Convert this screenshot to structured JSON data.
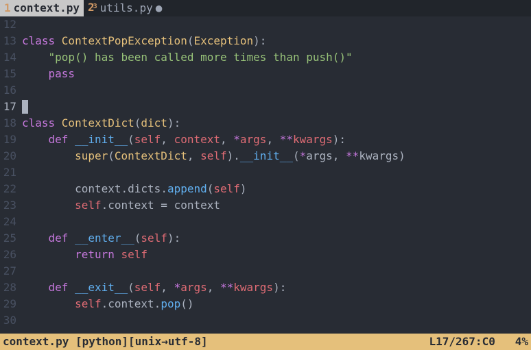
{
  "tabs": [
    {
      "index": "1",
      "sup": "",
      "name": "context.py",
      "active": true,
      "modified": false
    },
    {
      "index": "2",
      "sup": "3",
      "name": "utils.py",
      "active": false,
      "modified": true
    }
  ],
  "status": {
    "filename": "context.py",
    "filetype": "[python]",
    "encoding": "[unix→utf-8]",
    "position": "L17/267:C0",
    "percent": "4%"
  },
  "code": {
    "first_line_number": 12,
    "current_line": 17,
    "lines": [
      {
        "n": 12,
        "tokens": []
      },
      {
        "n": 13,
        "tokens": [
          {
            "t": "class ",
            "c": "kw"
          },
          {
            "t": "ContextPopException",
            "c": "cls"
          },
          {
            "t": "(",
            "c": "pun"
          },
          {
            "t": "Exception",
            "c": "bi"
          },
          {
            "t": "):",
            "c": "pun"
          }
        ]
      },
      {
        "n": 14,
        "tokens": [
          {
            "t": "    ",
            "c": "op"
          },
          {
            "t": "\"pop() has been called more times than push()\"",
            "c": "str"
          }
        ]
      },
      {
        "n": 15,
        "tokens": [
          {
            "t": "    ",
            "c": "op"
          },
          {
            "t": "pass",
            "c": "kw"
          }
        ]
      },
      {
        "n": 16,
        "tokens": []
      },
      {
        "n": 17,
        "tokens": [
          {
            "t": "CURSOR",
            "c": "cursor"
          }
        ]
      },
      {
        "n": 18,
        "tokens": [
          {
            "t": "class ",
            "c": "kw"
          },
          {
            "t": "ContextDict",
            "c": "cls"
          },
          {
            "t": "(",
            "c": "pun"
          },
          {
            "t": "dict",
            "c": "bi"
          },
          {
            "t": "):",
            "c": "pun"
          }
        ]
      },
      {
        "n": 19,
        "tokens": [
          {
            "t": "    ",
            "c": "op"
          },
          {
            "t": "def ",
            "c": "kw"
          },
          {
            "t": "__init__",
            "c": "fn"
          },
          {
            "t": "(",
            "c": "pun"
          },
          {
            "t": "self",
            "c": "slf"
          },
          {
            "t": ", ",
            "c": "pun"
          },
          {
            "t": "context",
            "c": "prm"
          },
          {
            "t": ", ",
            "c": "pun"
          },
          {
            "t": "*",
            "c": "star"
          },
          {
            "t": "args",
            "c": "prm"
          },
          {
            "t": ", ",
            "c": "pun"
          },
          {
            "t": "**",
            "c": "star"
          },
          {
            "t": "kwargs",
            "c": "prm"
          },
          {
            "t": "):",
            "c": "pun"
          }
        ]
      },
      {
        "n": 20,
        "tokens": [
          {
            "t": "        ",
            "c": "op"
          },
          {
            "t": "super",
            "c": "bi"
          },
          {
            "t": "(",
            "c": "pun"
          },
          {
            "t": "ContextDict",
            "c": "cls"
          },
          {
            "t": ", ",
            "c": "pun"
          },
          {
            "t": "self",
            "c": "slf"
          },
          {
            "t": ").",
            "c": "pun"
          },
          {
            "t": "__init__",
            "c": "fn"
          },
          {
            "t": "(",
            "c": "pun"
          },
          {
            "t": "*",
            "c": "star"
          },
          {
            "t": "args",
            "c": "op"
          },
          {
            "t": ", ",
            "c": "pun"
          },
          {
            "t": "**",
            "c": "star"
          },
          {
            "t": "kwargs",
            "c": "op"
          },
          {
            "t": ")",
            "c": "pun"
          }
        ]
      },
      {
        "n": 21,
        "tokens": []
      },
      {
        "n": 22,
        "tokens": [
          {
            "t": "        ",
            "c": "op"
          },
          {
            "t": "context",
            "c": "op"
          },
          {
            "t": ".",
            "c": "dot"
          },
          {
            "t": "dicts",
            "c": "op"
          },
          {
            "t": ".",
            "c": "dot"
          },
          {
            "t": "append",
            "c": "fn"
          },
          {
            "t": "(",
            "c": "pun"
          },
          {
            "t": "self",
            "c": "slf"
          },
          {
            "t": ")",
            "c": "pun"
          }
        ]
      },
      {
        "n": 23,
        "tokens": [
          {
            "t": "        ",
            "c": "op"
          },
          {
            "t": "self",
            "c": "slf"
          },
          {
            "t": ".",
            "c": "dot"
          },
          {
            "t": "context",
            "c": "op"
          },
          {
            "t": " = ",
            "c": "op"
          },
          {
            "t": "context",
            "c": "op"
          }
        ]
      },
      {
        "n": 24,
        "tokens": []
      },
      {
        "n": 25,
        "tokens": [
          {
            "t": "    ",
            "c": "op"
          },
          {
            "t": "def ",
            "c": "kw"
          },
          {
            "t": "__enter__",
            "c": "fn"
          },
          {
            "t": "(",
            "c": "pun"
          },
          {
            "t": "self",
            "c": "slf"
          },
          {
            "t": "):",
            "c": "pun"
          }
        ]
      },
      {
        "n": 26,
        "tokens": [
          {
            "t": "        ",
            "c": "op"
          },
          {
            "t": "return ",
            "c": "kw"
          },
          {
            "t": "self",
            "c": "slf"
          }
        ]
      },
      {
        "n": 27,
        "tokens": []
      },
      {
        "n": 28,
        "tokens": [
          {
            "t": "    ",
            "c": "op"
          },
          {
            "t": "def ",
            "c": "kw"
          },
          {
            "t": "__exit__",
            "c": "fn"
          },
          {
            "t": "(",
            "c": "pun"
          },
          {
            "t": "self",
            "c": "slf"
          },
          {
            "t": ", ",
            "c": "pun"
          },
          {
            "t": "*",
            "c": "star"
          },
          {
            "t": "args",
            "c": "prm"
          },
          {
            "t": ", ",
            "c": "pun"
          },
          {
            "t": "**",
            "c": "star"
          },
          {
            "t": "kwargs",
            "c": "prm"
          },
          {
            "t": "):",
            "c": "pun"
          }
        ]
      },
      {
        "n": 29,
        "tokens": [
          {
            "t": "        ",
            "c": "op"
          },
          {
            "t": "self",
            "c": "slf"
          },
          {
            "t": ".",
            "c": "dot"
          },
          {
            "t": "context",
            "c": "op"
          },
          {
            "t": ".",
            "c": "dot"
          },
          {
            "t": "pop",
            "c": "fn"
          },
          {
            "t": "()",
            "c": "pun"
          }
        ]
      },
      {
        "n": 30,
        "tokens": []
      }
    ]
  }
}
